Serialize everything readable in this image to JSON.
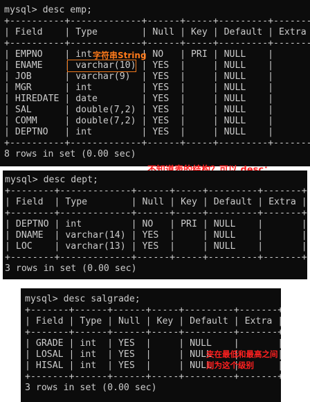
{
  "terminal_emp": {
    "lines": [
      "mysql> desc emp;",
      "+----------+-------------+------+-----+---------+-------+",
      "| Field    | Type        | Null | Key | Default | Extra |",
      "+----------+-------------+------+-----+---------+-------+",
      "| EMPNO    | int         | NO   | PRI | NULL    |       |",
      "| ENAME    | varchar(10) | YES  |     | NULL    |       |",
      "| JOB      | varchar(9)  | YES  |     | NULL    |       |",
      "| MGR      | int         | YES  |     | NULL    |       |",
      "| HIREDATE | date        | YES  |     | NULL    |       |",
      "| SAL      | double(7,2) | YES  |     | NULL    |       |",
      "| COMM     | double(7,2) | YES  |     | NULL    |       |",
      "| DEPTNO   | int         | YES  |     | NULL    |       |",
      "+----------+-------------+------+-----+---------+-------+",
      "8 rows in set (0.00 sec)"
    ]
  },
  "terminal_dept": {
    "lines": [
      "mysql> desc dept;",
      "+--------+-------------+------+-----+---------+-------+",
      "| Field  | Type        | Null | Key | Default | Extra |",
      "+--------+-------------+------+-----+---------+-------+",
      "| DEPTNO | int         | NO   | PRI | NULL    |       |",
      "| DNAME  | varchar(14) | YES  |     | NULL    |       |",
      "| LOC    | varchar(13) | YES  |     | NULL    |       |",
      "+--------+-------------+------+-----+---------+-------+",
      "3 rows in set (0.00 sec)"
    ]
  },
  "terminal_salgrade": {
    "lines": [
      "mysql> desc salgrade;",
      "+-------+------+------+-----+---------+-------+",
      "| Field | Type | Null | Key | Default | Extra |",
      "+-------+------+------+-----+---------+-------+",
      "| GRADE | int  | YES  |     | NULL    |       |",
      "| LOSAL | int  | YES  |     | NULL    |       |",
      "| HISAL | int  | YES  |     | NULL    |       |",
      "+-------+------+------+-----+---------+-------+",
      "3 rows in set (0.00 sec)"
    ]
  },
  "annotations": {
    "string_note": "字符串String",
    "desc_note": "不知道表的结构？可以 desc：",
    "range_note": "夹在最低和最高之间则为这个级别"
  },
  "colors": {
    "terminal_bg": "#0c0c0c",
    "terminal_text": "#cccccc",
    "annotation_orange": "#ff7a1a",
    "annotation_red": "#ff2020"
  }
}
